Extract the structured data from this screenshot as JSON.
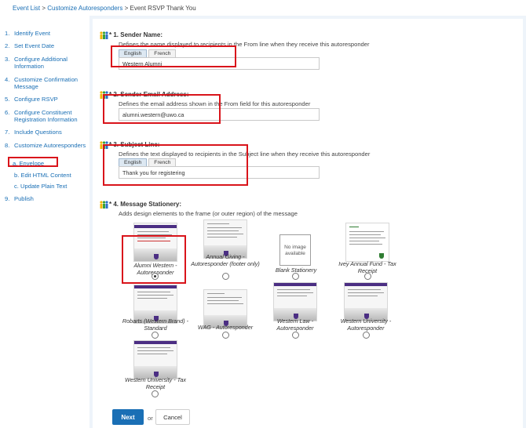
{
  "breadcrumb": {
    "items": [
      "Event List",
      "Customize Autoresponders"
    ],
    "separator": ">",
    "current": "Event RSVP Thank You"
  },
  "sidebar": {
    "items": [
      {
        "num": "1.",
        "label": "Identify Event"
      },
      {
        "num": "2.",
        "label": "Set Event Date"
      },
      {
        "num": "3.",
        "label": "Configure Additional Information"
      },
      {
        "num": "4.",
        "label": "Customize Confirmation Message"
      },
      {
        "num": "5.",
        "label": "Configure RSVP"
      },
      {
        "num": "6.",
        "label": "Configure Constituent Registration Information"
      },
      {
        "num": "7.",
        "label": "Include Questions"
      },
      {
        "num": "8.",
        "label": "Customize Autoresponders"
      },
      {
        "num": "9.",
        "label": "Publish"
      }
    ],
    "subitems": [
      "a. Envelope",
      "b. Edit HTML Content",
      "c. Update Plain Text"
    ]
  },
  "form": {
    "sender_name": {
      "title": "1. Sender Name:",
      "desc": "Defines the name displayed to recipients in the From line when they receive this autoresponder",
      "tabs": [
        "English",
        "French"
      ],
      "value": "Western Alumni"
    },
    "sender_email": {
      "title": "2. Sender Email Address:",
      "desc": "Defines the email address shown in the From field for this autoresponder",
      "value": "alumni.western@uwo.ca"
    },
    "subject": {
      "title": "3. Subject Line:",
      "desc": "Defines the text displayed to recipients in the Subject line when they receive this autoresponder",
      "tabs": [
        "English",
        "French"
      ],
      "value": "Thank you for registering"
    },
    "stationery": {
      "title": "4. Message Stationery:",
      "desc": "Adds design elements to the frame (or outer region) of the message",
      "no_image_text": "No image available",
      "options": [
        {
          "label": "Alumni Western - Autoresponder",
          "selected": true
        },
        {
          "label": "Annual Giving - Autoresponder (footer only)",
          "selected": false
        },
        {
          "label": "Blank Stationery",
          "selected": false
        },
        {
          "label": "Ivey Annual Fund - Tax Receipt",
          "selected": false
        },
        {
          "label": "Robarts (Western Brand) - Standard",
          "selected": false
        },
        {
          "label": "WAG - Autoresponder",
          "selected": false
        },
        {
          "label": "Western Law - Autoresponder",
          "selected": false
        },
        {
          "label": "Western University - Autoresponder",
          "selected": false
        },
        {
          "label": "Western University - Tax Receipt",
          "selected": false
        }
      ]
    }
  },
  "actions": {
    "next": "Next",
    "or": "or",
    "cancel": "Cancel"
  },
  "colors": {
    "link": "#1a6fb5",
    "highlight": "#d9141b",
    "primary_button": "#1a6fb5",
    "panel_bg": "#eef4fa"
  }
}
